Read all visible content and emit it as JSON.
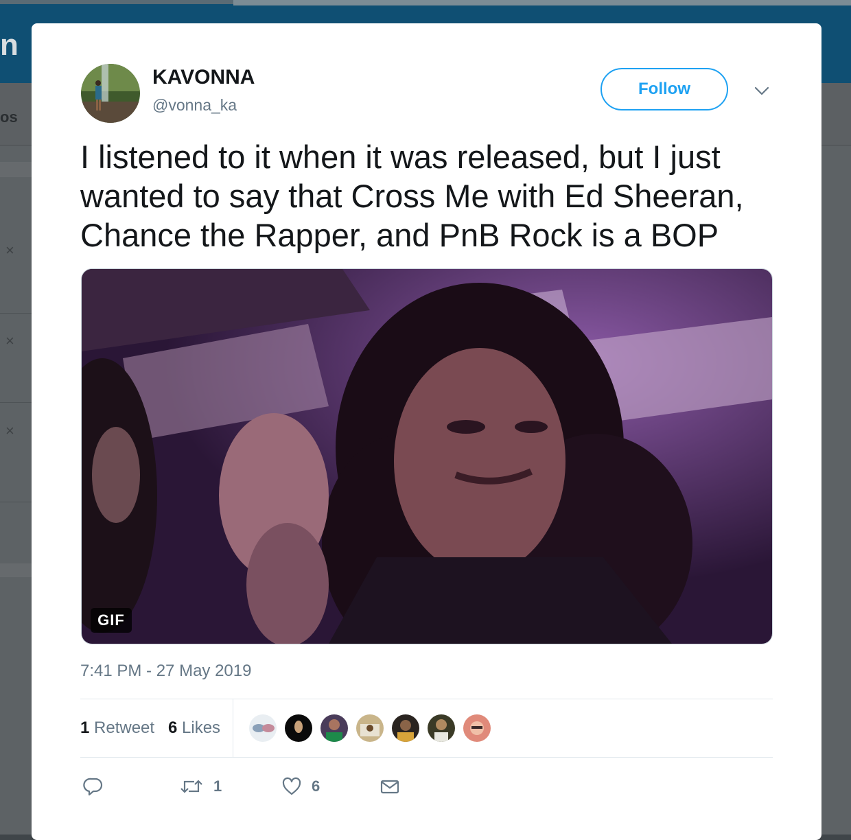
{
  "background": {
    "logo_fragment": "n",
    "nav_fragment": "os",
    "dismiss_glyph": "×"
  },
  "tweet": {
    "author_name": "KAVONNA",
    "author_handle": "@vonna_ka",
    "follow_label": "Follow",
    "text": "I listened to it when it was released, but I just wanted to say that Cross Me with Ed Sheeran, Chance the Rapper, and PnB Rock is a BOP",
    "media_badge": "GIF",
    "timestamp": "7:41 PM - 27 May 2019"
  },
  "stats": {
    "retweet_count": "1",
    "retweet_label": "Retweet",
    "like_count": "6",
    "like_label": "Likes",
    "liker_avatar_count": 7
  },
  "actions": {
    "reply_icon": "reply-icon",
    "retweet_count": "1",
    "like_count": "6",
    "dm_icon": "envelope-icon"
  },
  "colors": {
    "accent": "#1da1f2",
    "text": "#14171a",
    "muted": "#657786",
    "overlay_topbar": "#0f4f73"
  }
}
